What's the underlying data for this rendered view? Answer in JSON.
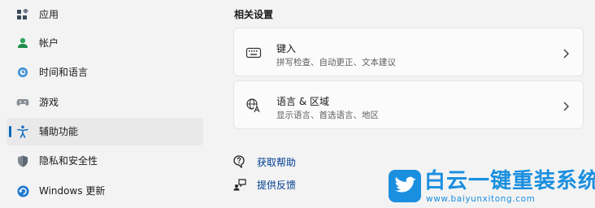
{
  "sidebar": {
    "items": [
      {
        "label": "应用",
        "icon": "apps-icon"
      },
      {
        "label": "帐户",
        "icon": "account-icon"
      },
      {
        "label": "时间和语言",
        "icon": "time-language-icon"
      },
      {
        "label": "游戏",
        "icon": "gaming-icon"
      },
      {
        "label": "辅助功能",
        "icon": "accessibility-icon",
        "selected": true
      },
      {
        "label": "隐私和安全性",
        "icon": "privacy-shield-icon"
      },
      {
        "label": "Windows 更新",
        "icon": "windows-update-icon"
      }
    ]
  },
  "main": {
    "section_title": "相关设置",
    "cards": [
      {
        "title": "键入",
        "subtitle": "拼写检查、自动更正、文本建议",
        "icon": "keyboard-icon"
      },
      {
        "title": "语言 & 区域",
        "subtitle": "显示语言、首选语言、地区",
        "icon": "language-region-icon"
      }
    ],
    "links": [
      {
        "label": "获取帮助",
        "icon": "help-icon"
      },
      {
        "label": "提供反馈",
        "icon": "feedback-icon"
      }
    ]
  },
  "watermark": {
    "brand": "白云一键重装系统",
    "url": "www.baiyunxitong.com"
  },
  "colors": {
    "accent": "#0067c0",
    "link": "#003e92",
    "watermark": "#1a8fe0"
  }
}
